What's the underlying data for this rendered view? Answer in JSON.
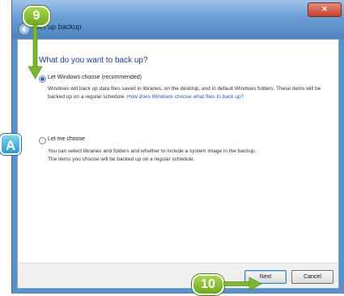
{
  "window": {
    "title": "Set up backup",
    "close_label": "✕"
  },
  "main": {
    "question": "What do you want to back up?",
    "options": [
      {
        "label": "Let Windows choose (recommended)",
        "checked": true,
        "description": "Windows will back up data files saved in libraries, on the desktop, and in default Windows folders. These items will be backed up on a regular schedule.",
        "link": "How does Windows choose what files to back up?"
      },
      {
        "label": "Let me choose",
        "checked": false,
        "description_line1": "You can select libraries and folders and whether to include a system image in the backup.",
        "description_line2": "The items you choose will be backed up on a regular schedule."
      }
    ]
  },
  "footer": {
    "next_label": "Next",
    "cancel_label": "Cancel"
  },
  "callouts": {
    "step9": "9",
    "stepA": "A",
    "step10": "10",
    "color_green": "#7cb82f",
    "color_blue": "#2d9ccc"
  }
}
